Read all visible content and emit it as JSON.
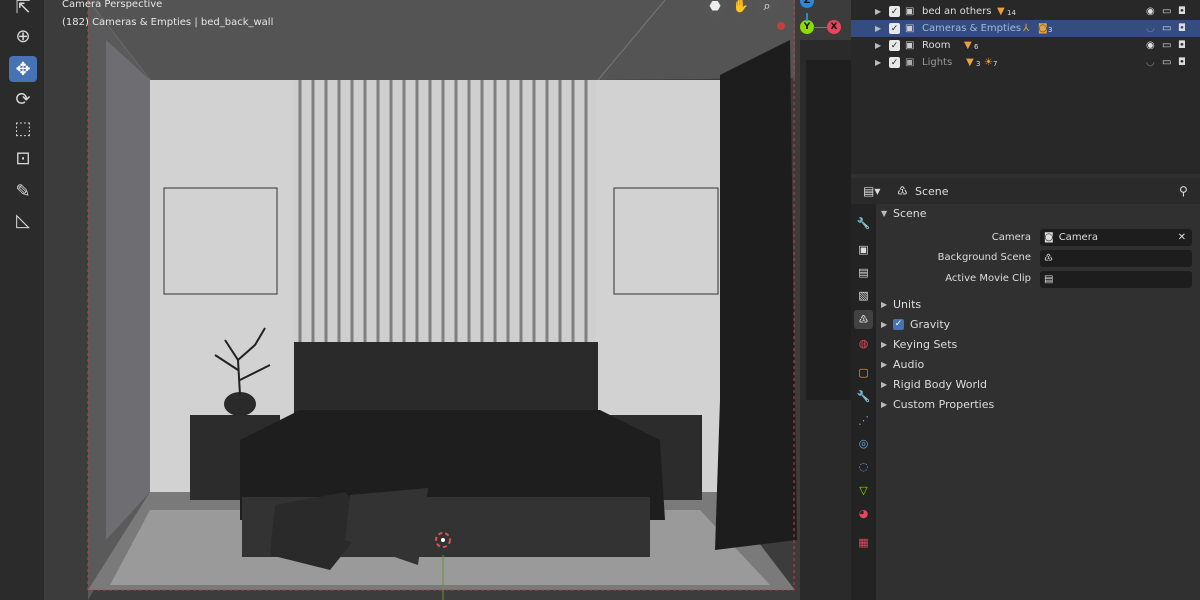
{
  "viewport": {
    "mode_label": "Camera Perspective",
    "scene_info": "(182) Cameras & Empties | bed_back_wall",
    "axis_z": "Z",
    "axis_y": "Y",
    "axis_x": "X"
  },
  "toolbar": {
    "tools": [
      "select-tool",
      "cursor-tool",
      "move-tool",
      "rotate-tool",
      "scale-tool",
      "transform-tool",
      "annotate-tool",
      "measure-tool"
    ]
  },
  "outliner": {
    "rows": [
      {
        "name": "bed an others",
        "badge": "14",
        "selected": false
      },
      {
        "name": "Cameras & Empties",
        "badge": "3",
        "selected": true
      },
      {
        "name": "Room",
        "badge": "6",
        "selected": false
      },
      {
        "name": "Lights",
        "badge1": "3",
        "badge2": "7",
        "selected": false
      }
    ]
  },
  "properties": {
    "context": "Scene",
    "panel_title": "Scene",
    "camera_label": "Camera",
    "camera_value": "Camera",
    "background_scene_label": "Background Scene",
    "active_movie_clip_label": "Active Movie Clip",
    "subpanels": [
      "Units",
      "Gravity",
      "Keying Sets",
      "Audio",
      "Rigid Body World",
      "Custom Properties"
    ]
  },
  "colors": {
    "accent": "#4772b3",
    "axis_x": "#e2475b",
    "axis_y": "#8bdc00",
    "axis_z": "#2f83e3"
  }
}
